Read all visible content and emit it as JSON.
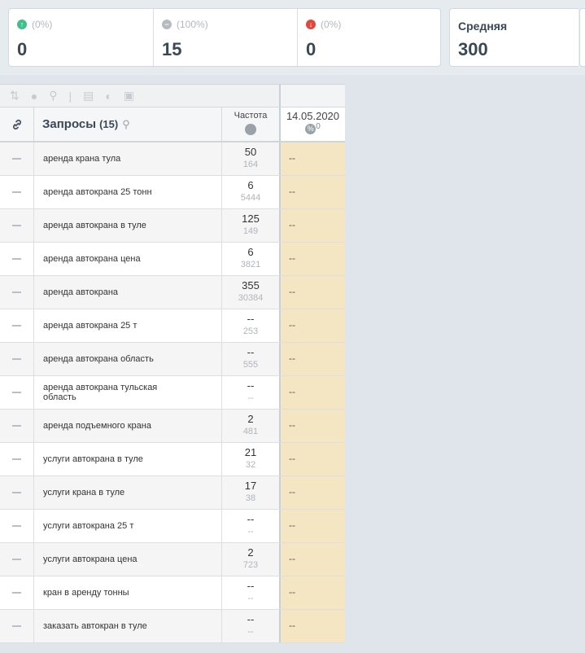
{
  "stats": {
    "up": {
      "pct": "(0%)",
      "value": "0",
      "color": "#3fbf8a"
    },
    "same": {
      "pct": "(100%)",
      "value": "15",
      "color": "#b5bbc0"
    },
    "down": {
      "pct": "(0%)",
      "value": "0",
      "color": "#e0483e"
    },
    "avg": {
      "label": "Средняя",
      "value": "300"
    }
  },
  "table": {
    "query_header": "Запросы",
    "query_count": "(15)",
    "freq_header": "Частота",
    "date_header": "14.05.2020",
    "date_sup": "0",
    "rows": [
      {
        "query": "аренда крана тула",
        "freq": "50",
        "freq2": "164",
        "pos": "--"
      },
      {
        "query": "аренда автокрана 25 тонн",
        "freq": "6",
        "freq2": "5444",
        "pos": "--"
      },
      {
        "query": "аренда автокрана в туле",
        "freq": "125",
        "freq2": "149",
        "pos": "--"
      },
      {
        "query": "аренда автокрана цена",
        "freq": "6",
        "freq2": "3821",
        "pos": "--"
      },
      {
        "query": "аренда автокрана",
        "freq": "355",
        "freq2": "30384",
        "pos": "--"
      },
      {
        "query": "аренда автокрана 25 т",
        "freq": "--",
        "freq2": "253",
        "pos": "--"
      },
      {
        "query": "аренда автокрана область",
        "freq": "--",
        "freq2": "555",
        "pos": "--"
      },
      {
        "query": "аренда автокрана тульская область",
        "freq": "--",
        "freq2": "--",
        "pos": "--"
      },
      {
        "query": "аренда подъемного крана",
        "freq": "2",
        "freq2": "481",
        "pos": "--"
      },
      {
        "query": "услуги автокрана в туле",
        "freq": "21",
        "freq2": "32",
        "pos": "--"
      },
      {
        "query": "услуги крана в туле",
        "freq": "17",
        "freq2": "38",
        "pos": "--"
      },
      {
        "query": "услуги автокрана 25 т",
        "freq": "--",
        "freq2": "--",
        "pos": "--"
      },
      {
        "query": "услуги автокрана цена",
        "freq": "2",
        "freq2": "723",
        "pos": "--"
      },
      {
        "query": "кран в аренду тонны",
        "freq": "--",
        "freq2": "--",
        "pos": "--"
      },
      {
        "query": "заказать автокран в туле",
        "freq": "--",
        "freq2": "--",
        "pos": "--"
      }
    ]
  },
  "icons": {
    "up": "arrow-up-circle-icon",
    "same": "minus-circle-icon",
    "down": "arrow-down-circle-icon",
    "link": "link-icon",
    "search": "search-icon",
    "globe": "globe-icon",
    "percent": "percent-icon"
  }
}
